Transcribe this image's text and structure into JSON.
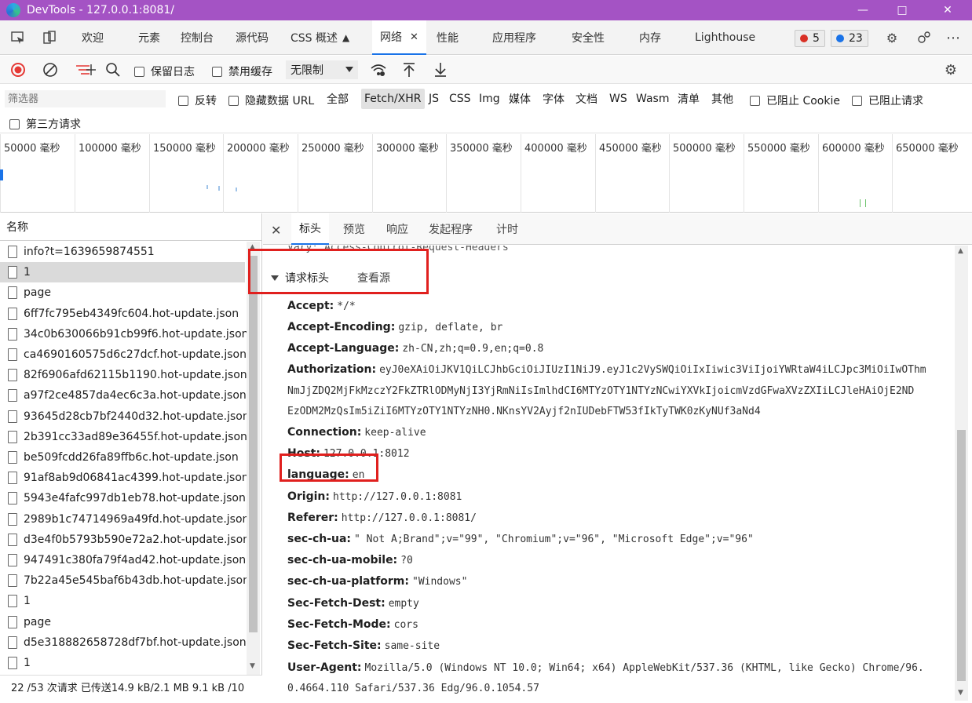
{
  "window": {
    "title": "DevTools - 127.0.0.1:8081/"
  },
  "main_tabs": [
    {
      "label": "欢迎"
    },
    {
      "label": "元素"
    },
    {
      "label": "控制台"
    },
    {
      "label": "源代码"
    },
    {
      "label": "CSS 概述"
    },
    {
      "label": "网络"
    },
    {
      "label": "性能"
    },
    {
      "label": "应用程序"
    },
    {
      "label": "安全性"
    },
    {
      "label": "内存"
    },
    {
      "label": "Lighthouse"
    }
  ],
  "badges": {
    "errors": "5",
    "messages": "23"
  },
  "toolbar": {
    "preserve_log": "保留日志",
    "disable_cache": "禁用缓存",
    "throttle": "无限制"
  },
  "filter": {
    "placeholder": "筛选器",
    "invert": "反转",
    "hide_data_urls": "隐藏数据 URL",
    "types": [
      "全部",
      "Fetch/XHR",
      "JS",
      "CSS",
      "Img",
      "媒体",
      "字体",
      "文档",
      "WS",
      "Wasm",
      "清单",
      "其他"
    ],
    "blocked_cookies": "已阻止 Cookie",
    "blocked_requests": "已阻止请求",
    "third_party": "第三方请求"
  },
  "timeline": {
    "ticks": [
      "50000 毫秒",
      "100000 毫秒",
      "150000 毫秒",
      "200000 毫秒",
      "250000 毫秒",
      "300000 毫秒",
      "350000 毫秒",
      "400000 毫秒",
      "450000 毫秒",
      "500000 毫秒",
      "550000 毫秒",
      "600000 毫秒",
      "650000 毫秒"
    ]
  },
  "requests": {
    "header": "名称",
    "rows": [
      "info?t=1639659874551",
      "1",
      "page",
      "6ff7fc795eb4349fc604.hot-update.json",
      "34c0b630066b91cb99f6.hot-update.json",
      "ca4690160575d6c27dcf.hot-update.json",
      "82f6906afd62115b1190.hot-update.json",
      "a97f2ce4857da4ec6c3a.hot-update.json",
      "93645d28cb7bf2440d32.hot-update.json",
      "2b391cc33ad89e36455f.hot-update.json",
      "be509fcdd26fa89ffb6c.hot-update.json",
      "91af8ab9d06841ac4399.hot-update.json",
      "5943e4fafc997db1eb78.hot-update.json",
      "2989b1c74714969a49fd.hot-update.json",
      "d3e4f0b5793b590e72a2.hot-update.json",
      "947491c380fa79f4ad42.hot-update.json",
      "7b22a45e545baf6b43db.hot-update.json",
      "1",
      "page",
      "d5e318882658728df7bf.hot-update.json",
      "1"
    ]
  },
  "status": "22 /53 次请求  已传送14.9 kB/2.1 MB  9.1 kB /10",
  "detail": {
    "tabs": [
      "标头",
      "预览",
      "响应",
      "发起程序",
      "计时"
    ],
    "clipped_line": "Vary: Access-Control-Request-Headers",
    "section_title": "请求标头",
    "view_source": "查看源",
    "headers": [
      {
        "name": "Accept:",
        "value": "*/*"
      },
      {
        "name": "Accept-Encoding:",
        "value": "gzip, deflate, br"
      },
      {
        "name": "Accept-Language:",
        "value": "zh-CN,zh;q=0.9,en;q=0.8"
      },
      {
        "name": "Authorization:",
        "value": "eyJ0eXAiOiJKV1QiLCJhbGciOiJIUzI1NiJ9.eyJ1c2VySWQiOiIxIiwic3ViIjoiYWRtaW4iLCJpc3MiOiIwOThm"
      },
      {
        "name": "",
        "value": "NmJjZDQ2MjFkMzczY2FkZTRlODMyNjI3YjRmNiIsImlhdCI6MTYzOTY1NTYzNCwiYXVkIjoicmVzdGFwaXVzZXIiLCJleHAiOjE2ND"
      },
      {
        "name": "",
        "value": "EzODM2MzQsIm5iZiI6MTYzOTY1NTYzNH0.NKnsYV2Ayjf2nIUDebFTW53fIkTyTWK0zKyNUf3aNd4"
      },
      {
        "name": "Connection:",
        "value": "keep-alive"
      },
      {
        "name": "Host:",
        "value": "127.0.0.1:8012"
      },
      {
        "name": "language:",
        "value": "en"
      },
      {
        "name": "Origin:",
        "value": "http://127.0.0.1:8081"
      },
      {
        "name": "Referer:",
        "value": "http://127.0.0.1:8081/"
      },
      {
        "name": "sec-ch-ua:",
        "value": "\" Not A;Brand\";v=\"99\", \"Chromium\";v=\"96\", \"Microsoft Edge\";v=\"96\""
      },
      {
        "name": "sec-ch-ua-mobile:",
        "value": "?0"
      },
      {
        "name": "sec-ch-ua-platform:",
        "value": "\"Windows\""
      },
      {
        "name": "Sec-Fetch-Dest:",
        "value": "empty"
      },
      {
        "name": "Sec-Fetch-Mode:",
        "value": "cors"
      },
      {
        "name": "Sec-Fetch-Site:",
        "value": "same-site"
      },
      {
        "name": "User-Agent:",
        "value": "Mozilla/5.0 (Windows NT 10.0; Win64; x64) AppleWebKit/537.36 (KHTML, like Gecko) Chrome/96."
      },
      {
        "name": "",
        "value": "0.4664.110 Safari/537.36 Edg/96.0.1054.57"
      }
    ]
  },
  "colors": {
    "titlebar": "#a453c4",
    "accent": "#1a73e8",
    "highlight": "#e0201e",
    "record": "#e53935"
  }
}
